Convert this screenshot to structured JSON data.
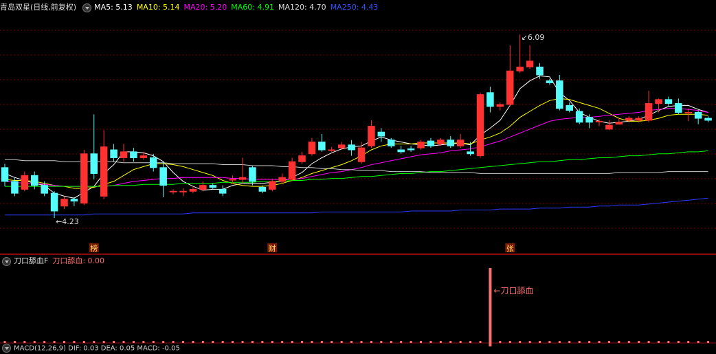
{
  "header": {
    "stock_title": "青岛双星(日线,前复权)",
    "ma": [
      {
        "label": "MA5: 5.13",
        "color": "#ffffff"
      },
      {
        "label": "MA10: 5.14",
        "color": "#ffff00"
      },
      {
        "label": "MA20: 5.20",
        "color": "#ff00ff"
      },
      {
        "label": "MA60: 4.91",
        "color": "#00ff00"
      },
      {
        "label": "MA120: 4.70",
        "color": "#dddddd"
      },
      {
        "label": "MA250: 4.43",
        "color": "#3355ff"
      }
    ]
  },
  "indicator": {
    "name": "刀口舔血F",
    "value_label": "刀口舔血: 0.00",
    "signal_text": "←刀口舔血"
  },
  "macd_label": "MACD(12,26,9)  DIF: 0.03  DEA: 0.05  MACD: -0.05",
  "colors": {
    "up": "#ff3232",
    "down": "#54fcfc",
    "grid": "#7a0000"
  },
  "chart_data": {
    "type": "candlestick",
    "ylim": [
      4.0,
      6.3
    ],
    "annotations": {
      "low_label": "4.23",
      "low_index": 5,
      "high_label": "6.09",
      "high_index": 52
    },
    "markers": [
      {
        "index": 9,
        "text": "榜"
      },
      {
        "index": 27,
        "text": "财"
      },
      {
        "index": 51,
        "text": "张"
      }
    ],
    "candles": [
      [
        4.74,
        4.6,
        4.78,
        4.55
      ],
      [
        4.6,
        4.48,
        4.64,
        4.45
      ],
      [
        4.52,
        4.66,
        4.7,
        4.5
      ],
      [
        4.66,
        4.56,
        4.7,
        4.52
      ],
      [
        4.56,
        4.48,
        4.6,
        4.45
      ],
      [
        4.48,
        4.3,
        4.5,
        4.23
      ],
      [
        4.35,
        4.42,
        4.45,
        4.32
      ],
      [
        4.42,
        4.4,
        4.44,
        4.35
      ],
      [
        4.38,
        4.88,
        4.92,
        4.36
      ],
      [
        4.88,
        4.68,
        5.28,
        4.62
      ],
      [
        4.45,
        4.95,
        5.12,
        4.42
      ],
      [
        4.92,
        4.84,
        4.98,
        4.8
      ],
      [
        4.84,
        4.9,
        4.98,
        4.8
      ],
      [
        4.9,
        4.84,
        4.94,
        4.8
      ],
      [
        4.84,
        4.86,
        4.9,
        4.82
      ],
      [
        4.84,
        4.74,
        4.88,
        4.7
      ],
      [
        4.74,
        4.56,
        4.8,
        4.44
      ],
      [
        4.5,
        4.5,
        4.52,
        4.47
      ],
      [
        4.5,
        4.5,
        4.53,
        4.45
      ],
      [
        4.5,
        4.52,
        4.55,
        4.48
      ],
      [
        4.52,
        4.56,
        4.6,
        4.5
      ],
      [
        4.56,
        4.54,
        4.58,
        4.52
      ],
      [
        4.52,
        4.48,
        4.56,
        4.45
      ],
      [
        4.62,
        4.62,
        4.66,
        4.58
      ],
      [
        4.62,
        4.64,
        4.84,
        4.58
      ],
      [
        4.74,
        4.6,
        4.76,
        4.56
      ],
      [
        4.54,
        4.5,
        4.56,
        4.48
      ],
      [
        4.52,
        4.6,
        4.62,
        4.5
      ],
      [
        4.6,
        4.64,
        4.68,
        4.58
      ],
      [
        4.62,
        4.8,
        4.84,
        4.6
      ],
      [
        4.8,
        4.86,
        4.9,
        4.78
      ],
      [
        4.88,
        5.0,
        5.04,
        4.86
      ],
      [
        5.0,
        4.92,
        5.08,
        4.9
      ],
      [
        4.92,
        4.92,
        4.95,
        4.9
      ],
      [
        4.94,
        4.97,
        5.0,
        4.92
      ],
      [
        4.97,
        4.92,
        5.02,
        4.86
      ],
      [
        4.8,
        4.94,
        5.0,
        4.78
      ],
      [
        4.96,
        5.16,
        5.22,
        4.94
      ],
      [
        5.1,
        5.06,
        5.14,
        5.0
      ],
      [
        5.02,
        4.96,
        5.04,
        4.94
      ],
      [
        4.92,
        4.9,
        4.96,
        4.88
      ],
      [
        4.93,
        4.92,
        4.96,
        4.9
      ],
      [
        4.94,
        5.0,
        5.02,
        4.92
      ],
      [
        5.01,
        4.96,
        5.04,
        4.94
      ],
      [
        4.98,
        5.02,
        5.04,
        4.96
      ],
      [
        5.02,
        4.96,
        5.06,
        4.94
      ],
      [
        4.96,
        5.02,
        5.08,
        4.94
      ],
      [
        4.9,
        4.88,
        5.0,
        4.86
      ],
      [
        4.86,
        5.48,
        5.5,
        4.84
      ],
      [
        5.5,
        5.36,
        5.56,
        5.3
      ],
      [
        5.36,
        5.38,
        5.4,
        5.32
      ],
      [
        5.38,
        5.72,
        5.98,
        5.36
      ],
      [
        5.72,
        5.76,
        6.09,
        5.7
      ],
      [
        5.76,
        5.82,
        5.98,
        5.74
      ],
      [
        5.76,
        5.68,
        5.8,
        5.64
      ],
      [
        5.62,
        5.6,
        5.64,
        5.58
      ],
      [
        5.62,
        5.34,
        5.68,
        5.32
      ],
      [
        5.37,
        5.32,
        5.4,
        5.3
      ],
      [
        5.31,
        5.2,
        5.34,
        5.18
      ],
      [
        5.25,
        5.2,
        5.28,
        5.14
      ],
      [
        5.21,
        5.21,
        5.23,
        5.16
      ],
      [
        5.13,
        5.17,
        5.22,
        5.12
      ],
      [
        5.18,
        5.2,
        5.24,
        5.18
      ],
      [
        5.22,
        5.24,
        5.26,
        5.2
      ],
      [
        5.22,
        5.24,
        5.26,
        5.2
      ],
      [
        5.22,
        5.39,
        5.52,
        5.2
      ],
      [
        5.39,
        5.43,
        5.44,
        5.3
      ],
      [
        5.43,
        5.39,
        5.46,
        5.36
      ],
      [
        5.39,
        5.3,
        5.44,
        5.28
      ],
      [
        5.3,
        5.3,
        5.34,
        5.21
      ],
      [
        5.3,
        5.24,
        5.32,
        5.18
      ],
      [
        5.24,
        5.22,
        5.26,
        5.2
      ]
    ],
    "ma_values": {
      "MA5": [
        4.68,
        4.64,
        4.61,
        4.58,
        4.56,
        4.48,
        4.45,
        4.43,
        4.49,
        4.55,
        4.68,
        4.77,
        4.9,
        4.9,
        4.89,
        4.86,
        4.8,
        4.69,
        4.6,
        4.55,
        4.51,
        4.52,
        4.52,
        4.56,
        4.58,
        4.58,
        4.58,
        4.59,
        4.6,
        4.64,
        4.69,
        4.78,
        4.84,
        4.89,
        4.93,
        4.95,
        4.96,
        5.01,
        5.05,
        5.02,
        5.0,
        4.98,
        4.97,
        4.96,
        4.97,
        4.98,
        4.99,
        4.97,
        5.07,
        5.14,
        5.22,
        5.37,
        5.54,
        5.62,
        5.67,
        5.66,
        5.5,
        5.42,
        5.3,
        5.25,
        5.21,
        5.19,
        5.2,
        5.21,
        5.23,
        5.27,
        5.32,
        5.36,
        5.37,
        5.37,
        5.33,
        5.3
      ],
      "MA10": [
        4.62,
        4.61,
        4.61,
        4.6,
        4.58,
        4.56,
        4.55,
        4.53,
        4.53,
        4.54,
        4.57,
        4.6,
        4.66,
        4.72,
        4.75,
        4.78,
        4.78,
        4.77,
        4.75,
        4.72,
        4.69,
        4.66,
        4.61,
        4.58,
        4.56,
        4.55,
        4.55,
        4.56,
        4.58,
        4.61,
        4.64,
        4.68,
        4.71,
        4.74,
        4.77,
        4.81,
        4.86,
        4.92,
        4.96,
        4.98,
        4.98,
        4.98,
        4.99,
        4.99,
        4.99,
        4.99,
        4.99,
        4.98,
        5.02,
        5.05,
        5.09,
        5.16,
        5.25,
        5.31,
        5.37,
        5.42,
        5.44,
        5.43,
        5.4,
        5.37,
        5.34,
        5.29,
        5.24,
        5.21,
        5.21,
        5.22,
        5.24,
        5.27,
        5.28,
        5.28,
        5.28,
        5.27
      ],
      "MA20": [
        4.6,
        4.59,
        4.58,
        4.58,
        4.57,
        4.56,
        4.55,
        4.55,
        4.55,
        4.55,
        4.55,
        4.56,
        4.58,
        4.6,
        4.61,
        4.62,
        4.63,
        4.63,
        4.64,
        4.64,
        4.64,
        4.64,
        4.64,
        4.63,
        4.63,
        4.62,
        4.62,
        4.62,
        4.62,
        4.62,
        4.63,
        4.65,
        4.67,
        4.69,
        4.7,
        4.72,
        4.74,
        4.77,
        4.79,
        4.81,
        4.83,
        4.85,
        4.87,
        4.88,
        4.89,
        4.91,
        4.92,
        4.93,
        4.95,
        4.98,
        5.01,
        5.05,
        5.09,
        5.13,
        5.17,
        5.21,
        5.23,
        5.24,
        5.25,
        5.25,
        5.26,
        5.27,
        5.28,
        5.29,
        5.3,
        5.32,
        5.33,
        5.34,
        5.34,
        5.33,
        5.32,
        5.3
      ],
      "MA60": [
        4.55,
        4.55,
        4.55,
        4.55,
        4.55,
        4.55,
        4.55,
        4.55,
        4.55,
        4.55,
        4.55,
        4.56,
        4.56,
        4.56,
        4.57,
        4.57,
        4.57,
        4.57,
        4.58,
        4.58,
        4.58,
        4.58,
        4.59,
        4.59,
        4.59,
        4.59,
        4.6,
        4.6,
        4.6,
        4.61,
        4.61,
        4.62,
        4.62,
        4.63,
        4.63,
        4.64,
        4.65,
        4.65,
        4.66,
        4.67,
        4.68,
        4.68,
        4.69,
        4.7,
        4.7,
        4.71,
        4.72,
        4.73,
        4.74,
        4.75,
        4.76,
        4.77,
        4.78,
        4.79,
        4.8,
        4.8,
        4.81,
        4.82,
        4.82,
        4.83,
        4.84,
        4.84,
        4.85,
        4.86,
        4.86,
        4.87,
        4.88,
        4.88,
        4.89,
        4.9,
        4.9,
        4.91
      ],
      "MA120": [
        4.82,
        4.82,
        4.81,
        4.81,
        4.81,
        4.81,
        4.8,
        4.8,
        4.8,
        4.8,
        4.8,
        4.8,
        4.79,
        4.79,
        4.79,
        4.79,
        4.79,
        4.78,
        4.78,
        4.78,
        4.78,
        4.78,
        4.77,
        4.77,
        4.77,
        4.76,
        4.76,
        4.76,
        4.75,
        4.75,
        4.74,
        4.74,
        4.73,
        4.73,
        4.72,
        4.72,
        4.71,
        4.71,
        4.71,
        4.7,
        4.7,
        4.7,
        4.7,
        4.69,
        4.69,
        4.69,
        4.69,
        4.69,
        4.68,
        4.68,
        4.68,
        4.68,
        4.68,
        4.68,
        4.68,
        4.68,
        4.68,
        4.68,
        4.68,
        4.68,
        4.68,
        4.68,
        4.69,
        4.69,
        4.69,
        4.69,
        4.69,
        4.7,
        4.7,
        4.7,
        4.7,
        4.7
      ],
      "MA250": [
        4.26,
        4.26,
        4.26,
        4.26,
        4.26,
        4.26,
        4.26,
        4.26,
        4.26,
        4.27,
        4.27,
        4.27,
        4.27,
        4.27,
        4.27,
        4.27,
        4.27,
        4.27,
        4.27,
        4.28,
        4.28,
        4.28,
        4.28,
        4.28,
        4.28,
        4.28,
        4.28,
        4.28,
        4.28,
        4.28,
        4.28,
        4.28,
        4.29,
        4.29,
        4.29,
        4.29,
        4.29,
        4.29,
        4.29,
        4.29,
        4.29,
        4.3,
        4.3,
        4.3,
        4.3,
        4.3,
        4.31,
        4.31,
        4.31,
        4.31,
        4.32,
        4.32,
        4.32,
        4.32,
        4.33,
        4.33,
        4.33,
        4.34,
        4.34,
        4.34,
        4.35,
        4.35,
        4.36,
        4.36,
        4.36,
        4.37,
        4.38,
        4.39,
        4.4,
        4.41,
        4.42,
        4.43
      ]
    },
    "indicator_signals": [
      49
    ]
  }
}
